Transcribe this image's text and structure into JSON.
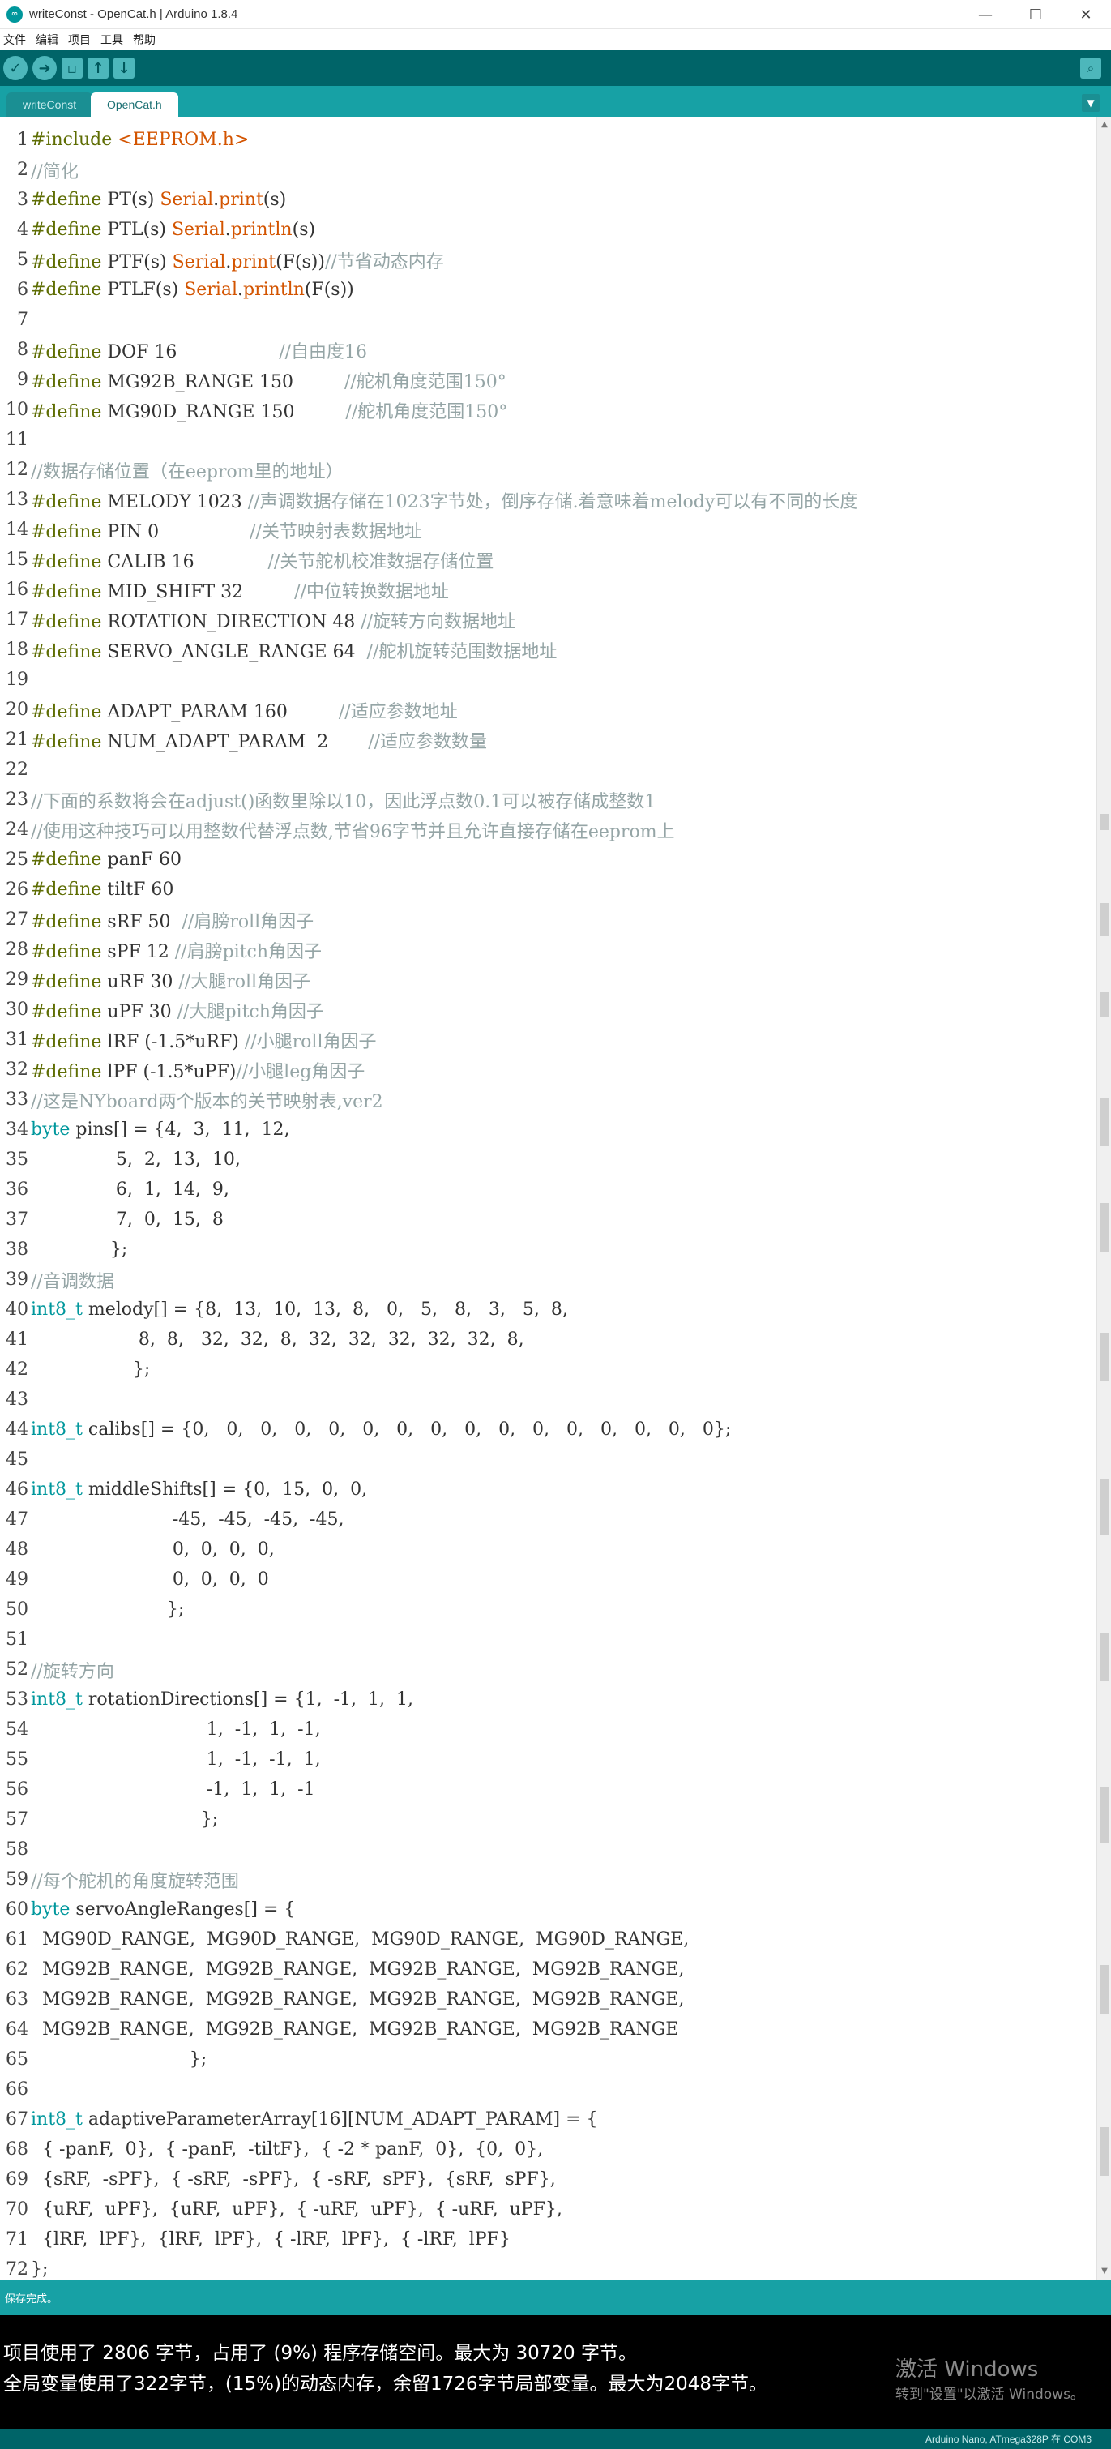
{
  "window": {
    "title": "writeConst - OpenCat.h | Arduino 1.8.4",
    "minimize_glyph": "—",
    "maximize_glyph": "☐",
    "close_glyph": "✕"
  },
  "menu": [
    "文件",
    "编辑",
    "项目",
    "工具",
    "帮助"
  ],
  "toolbar": {
    "icons": [
      "verify-icon",
      "upload-icon",
      "new-icon",
      "open-icon",
      "save-icon",
      "serial-monitor-icon"
    ]
  },
  "tabs": [
    {
      "label": "writeConst",
      "active": false
    },
    {
      "label": "OpenCat.h",
      "active": true
    }
  ],
  "editor": {
    "lines": [
      {
        "n": 1,
        "tokens": [
          [
            "pre",
            "#include "
          ],
          [
            "fn",
            "<EEPROM.h>"
          ]
        ]
      },
      {
        "n": 2,
        "tokens": [
          [
            "cm",
            "//简化"
          ]
        ]
      },
      {
        "n": 3,
        "tokens": [
          [
            "pre",
            "#define "
          ],
          [
            "pl",
            "PT(s) "
          ],
          [
            "fn",
            "Serial"
          ],
          [
            "pl",
            "."
          ],
          [
            "fn",
            "print"
          ],
          [
            "pl",
            "(s)"
          ]
        ]
      },
      {
        "n": 4,
        "tokens": [
          [
            "pre",
            "#define "
          ],
          [
            "pl",
            "PTL(s) "
          ],
          [
            "fn",
            "Serial"
          ],
          [
            "pl",
            "."
          ],
          [
            "fn",
            "println"
          ],
          [
            "pl",
            "(s)"
          ]
        ]
      },
      {
        "n": 5,
        "tokens": [
          [
            "pre",
            "#define "
          ],
          [
            "pl",
            "PTF(s) "
          ],
          [
            "fn",
            "Serial"
          ],
          [
            "pl",
            "."
          ],
          [
            "fn",
            "print"
          ],
          [
            "pl",
            "(F(s))"
          ],
          [
            "cm",
            "//节省动态内存"
          ]
        ]
      },
      {
        "n": 6,
        "tokens": [
          [
            "pre",
            "#define "
          ],
          [
            "pl",
            "PTLF(s) "
          ],
          [
            "fn",
            "Serial"
          ],
          [
            "pl",
            "."
          ],
          [
            "fn",
            "println"
          ],
          [
            "pl",
            "(F(s))"
          ]
        ]
      },
      {
        "n": 7,
        "tokens": []
      },
      {
        "n": 8,
        "tokens": [
          [
            "pre",
            "#define "
          ],
          [
            "pl",
            "DOF 16                  "
          ],
          [
            "cm",
            "//自由度16"
          ]
        ]
      },
      {
        "n": 9,
        "tokens": [
          [
            "pre",
            "#define "
          ],
          [
            "pl",
            "MG92B_RANGE 150         "
          ],
          [
            "cm",
            "//舵机角度范围150°"
          ]
        ]
      },
      {
        "n": 10,
        "tokens": [
          [
            "pre",
            "#define "
          ],
          [
            "pl",
            "MG90D_RANGE 150         "
          ],
          [
            "cm",
            "//舵机角度范围150°"
          ]
        ]
      },
      {
        "n": 11,
        "tokens": []
      },
      {
        "n": 12,
        "tokens": [
          [
            "cm",
            "//数据存储位置（在eeprom里的地址）"
          ]
        ]
      },
      {
        "n": 13,
        "tokens": [
          [
            "pre",
            "#define "
          ],
          [
            "pl",
            "MELODY 1023 "
          ],
          [
            "cm",
            "//声调数据存储在1023字节处，倒序存储.着意味着melody可以有不同的长度"
          ]
        ]
      },
      {
        "n": 14,
        "tokens": [
          [
            "pre",
            "#define "
          ],
          [
            "pl",
            "PIN 0                "
          ],
          [
            "cm",
            "//关节映射表数据地址"
          ]
        ]
      },
      {
        "n": 15,
        "tokens": [
          [
            "pre",
            "#define "
          ],
          [
            "pl",
            "CALIB 16             "
          ],
          [
            "cm",
            "//关节舵机校准数据存储位置"
          ]
        ]
      },
      {
        "n": 16,
        "tokens": [
          [
            "pre",
            "#define "
          ],
          [
            "pl",
            "MID_SHIFT 32         "
          ],
          [
            "cm",
            "//中位转换数据地址"
          ]
        ]
      },
      {
        "n": 17,
        "tokens": [
          [
            "pre",
            "#define "
          ],
          [
            "pl",
            "ROTATION_DIRECTION 48 "
          ],
          [
            "cm",
            "//旋转方向数据地址"
          ]
        ]
      },
      {
        "n": 18,
        "tokens": [
          [
            "pre",
            "#define "
          ],
          [
            "pl",
            "SERVO_ANGLE_RANGE 64  "
          ],
          [
            "cm",
            "//舵机旋转范围数据地址"
          ]
        ]
      },
      {
        "n": 19,
        "tokens": []
      },
      {
        "n": 20,
        "tokens": [
          [
            "pre",
            "#define "
          ],
          [
            "pl",
            "ADAPT_PARAM 160         "
          ],
          [
            "cm",
            "//适应参数地址"
          ]
        ]
      },
      {
        "n": 21,
        "tokens": [
          [
            "pre",
            "#define "
          ],
          [
            "pl",
            "NUM_ADAPT_PARAM  2       "
          ],
          [
            "cm",
            "//适应参数数量"
          ]
        ]
      },
      {
        "n": 22,
        "tokens": []
      },
      {
        "n": 23,
        "tokens": [
          [
            "cm",
            "//下面的系数将会在adjust()函数里除以10，因此浮点数0.1可以被存储成整数1"
          ]
        ]
      },
      {
        "n": 24,
        "tokens": [
          [
            "cm",
            "//使用这种技巧可以用整数代替浮点数,节省96字节并且允许直接存储在eeprom上"
          ]
        ]
      },
      {
        "n": 25,
        "tokens": [
          [
            "pre",
            "#define "
          ],
          [
            "pl",
            "panF 60"
          ]
        ]
      },
      {
        "n": 26,
        "tokens": [
          [
            "pre",
            "#define "
          ],
          [
            "pl",
            "tiltF 60"
          ]
        ]
      },
      {
        "n": 27,
        "tokens": [
          [
            "pre",
            "#define "
          ],
          [
            "pl",
            "sRF 50  "
          ],
          [
            "cm",
            "//肩膀roll角因子"
          ]
        ]
      },
      {
        "n": 28,
        "tokens": [
          [
            "pre",
            "#define "
          ],
          [
            "pl",
            "sPF 12 "
          ],
          [
            "cm",
            "//肩膀pitch角因子"
          ]
        ]
      },
      {
        "n": 29,
        "tokens": [
          [
            "pre",
            "#define "
          ],
          [
            "pl",
            "uRF 30 "
          ],
          [
            "cm",
            "//大腿roll角因子"
          ]
        ]
      },
      {
        "n": 30,
        "tokens": [
          [
            "pre",
            "#define "
          ],
          [
            "pl",
            "uPF 30 "
          ],
          [
            "cm",
            "//大腿pitch角因子"
          ]
        ]
      },
      {
        "n": 31,
        "tokens": [
          [
            "pre",
            "#define "
          ],
          [
            "pl",
            "lRF (-1.5*uRF) "
          ],
          [
            "cm",
            "//小腿roll角因子"
          ]
        ]
      },
      {
        "n": 32,
        "tokens": [
          [
            "pre",
            "#define "
          ],
          [
            "pl",
            "lPF (-1.5*uPF)"
          ],
          [
            "cm",
            "//小腿leg角因子"
          ]
        ]
      },
      {
        "n": 33,
        "tokens": [
          [
            "cm",
            "//这是NYboard两个版本的关节映射表,ver2"
          ]
        ]
      },
      {
        "n": 34,
        "tokens": [
          [
            "kw",
            "byte"
          ],
          [
            "pl",
            " pins[] = {4,  3,  11,  12,"
          ]
        ]
      },
      {
        "n": 35,
        "tokens": [
          [
            "pl",
            "               5,  2,  13,  10,"
          ]
        ]
      },
      {
        "n": 36,
        "tokens": [
          [
            "pl",
            "               6,  1,  14,  9,"
          ]
        ]
      },
      {
        "n": 37,
        "tokens": [
          [
            "pl",
            "               7,  0,  15,  8"
          ]
        ]
      },
      {
        "n": 38,
        "tokens": [
          [
            "pl",
            "              };"
          ]
        ]
      },
      {
        "n": 39,
        "tokens": [
          [
            "cm",
            "//音调数据"
          ]
        ]
      },
      {
        "n": 40,
        "tokens": [
          [
            "kw",
            "int8_t"
          ],
          [
            "pl",
            " melody[] = {8,  13,  10,  13,  8,   0,   5,   8,   3,   5,  8,"
          ]
        ]
      },
      {
        "n": 41,
        "tokens": [
          [
            "pl",
            "                   8,  8,   32,  32,  8,  32,  32,  32,  32,  32,  8,"
          ]
        ]
      },
      {
        "n": 42,
        "tokens": [
          [
            "pl",
            "                  };"
          ]
        ]
      },
      {
        "n": 43,
        "tokens": []
      },
      {
        "n": 44,
        "tokens": [
          [
            "kw",
            "int8_t"
          ],
          [
            "pl",
            " calibs[] = {0,   0,   0,   0,   0,   0,   0,   0,   0,   0,   0,   0,   0,   0,   0,   0};"
          ]
        ]
      },
      {
        "n": 45,
        "tokens": []
      },
      {
        "n": 46,
        "tokens": [
          [
            "kw",
            "int8_t"
          ],
          [
            "pl",
            " middleShifts[] = {0,  15,  0,  0,"
          ]
        ]
      },
      {
        "n": 47,
        "tokens": [
          [
            "pl",
            "                         -45,  -45,  -45,  -45,"
          ]
        ]
      },
      {
        "n": 48,
        "tokens": [
          [
            "pl",
            "                         0,  0,  0,  0,"
          ]
        ]
      },
      {
        "n": 49,
        "tokens": [
          [
            "pl",
            "                         0,  0,  0,  0"
          ]
        ]
      },
      {
        "n": 50,
        "tokens": [
          [
            "pl",
            "                        };"
          ]
        ]
      },
      {
        "n": 51,
        "tokens": []
      },
      {
        "n": 52,
        "tokens": [
          [
            "cm",
            "//旋转方向"
          ]
        ]
      },
      {
        "n": 53,
        "tokens": [
          [
            "kw",
            "int8_t"
          ],
          [
            "pl",
            " rotationDirections[] = {1,  -1,  1,  1,"
          ]
        ]
      },
      {
        "n": 54,
        "tokens": [
          [
            "pl",
            "                               1,  -1,  1,  -1,"
          ]
        ]
      },
      {
        "n": 55,
        "tokens": [
          [
            "pl",
            "                               1,  -1,  -1,  1,"
          ]
        ]
      },
      {
        "n": 56,
        "tokens": [
          [
            "pl",
            "                               -1,  1,  1,  -1"
          ]
        ]
      },
      {
        "n": 57,
        "tokens": [
          [
            "pl",
            "                              };"
          ]
        ]
      },
      {
        "n": 58,
        "tokens": []
      },
      {
        "n": 59,
        "tokens": [
          [
            "cm",
            "//每个舵机的角度旋转范围"
          ]
        ]
      },
      {
        "n": 60,
        "tokens": [
          [
            "kw",
            "byte"
          ],
          [
            "pl",
            " servoAngleRanges[] = {"
          ]
        ]
      },
      {
        "n": 61,
        "tokens": [
          [
            "pl",
            "  MG90D_RANGE,  MG90D_RANGE,  MG90D_RANGE,  MG90D_RANGE,"
          ]
        ]
      },
      {
        "n": 62,
        "tokens": [
          [
            "pl",
            "  MG92B_RANGE,  MG92B_RANGE,  MG92B_RANGE,  MG92B_RANGE,"
          ]
        ]
      },
      {
        "n": 63,
        "tokens": [
          [
            "pl",
            "  MG92B_RANGE,  MG92B_RANGE,  MG92B_RANGE,  MG92B_RANGE,"
          ]
        ]
      },
      {
        "n": 64,
        "tokens": [
          [
            "pl",
            "  MG92B_RANGE,  MG92B_RANGE,  MG92B_RANGE,  MG92B_RANGE"
          ]
        ]
      },
      {
        "n": 65,
        "tokens": [
          [
            "pl",
            "                            };"
          ]
        ]
      },
      {
        "n": 66,
        "tokens": []
      },
      {
        "n": 67,
        "tokens": [
          [
            "kw",
            "int8_t"
          ],
          [
            "pl",
            " adaptiveParameterArray[16][NUM_ADAPT_PARAM] = {"
          ]
        ]
      },
      {
        "n": 68,
        "tokens": [
          [
            "pl",
            "  { -panF,  0},  { -panF,  -tiltF},  { -2 * panF,  0},  {0,  0},"
          ]
        ]
      },
      {
        "n": 69,
        "tokens": [
          [
            "pl",
            "  {sRF,  -sPF},  { -sRF,  -sPF},  { -sRF,  sPF},  {sRF,  sPF},"
          ]
        ]
      },
      {
        "n": 70,
        "tokens": [
          [
            "pl",
            "  {uRF,  uPF},  {uRF,  uPF},  { -uRF,  uPF},  { -uRF,  uPF},"
          ]
        ]
      },
      {
        "n": 71,
        "tokens": [
          [
            "pl",
            "  {lRF,  lPF},  {lRF,  lPF},  { -lRF,  lPF},  { -lRF,  lPF}"
          ]
        ]
      },
      {
        "n": 72,
        "tokens": [
          [
            "pl",
            "};"
          ]
        ]
      }
    ]
  },
  "status": {
    "text": "保存完成。"
  },
  "console": {
    "lines": [
      "项目使用了 2806 字节，占用了 (9%) 程序存储空间。最大为 30720 字节。",
      "全局变量使用了322字节，(15%)的动态内存，余留1726字节局部变量。最大为2048字节。"
    ]
  },
  "watermark": {
    "line1": "激活 Windows",
    "line2": "转到\"设置\"以激活 Windows。"
  },
  "board_info": "Arduino Nano, ATmega328P 在 COM3"
}
